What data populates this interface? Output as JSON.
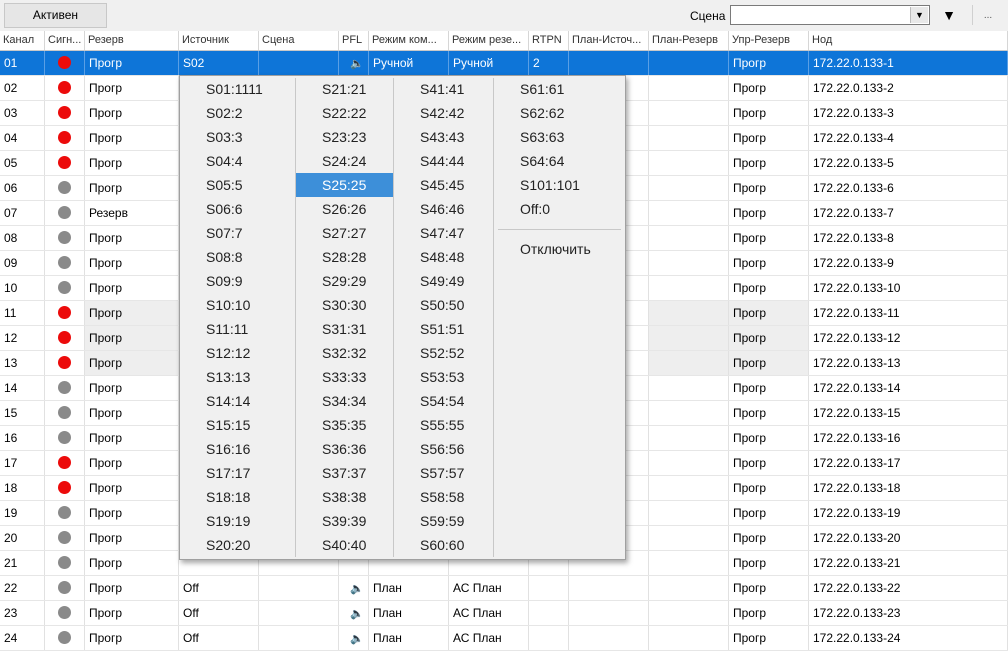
{
  "toolbar": {
    "active_label": "Активен",
    "scene_label": "Сцена",
    "scene_value": "",
    "more_label": "..."
  },
  "columns": [
    "Канал",
    "Сигн...",
    "Резерв",
    "Источник",
    "Сцена",
    "PFL",
    "Режим ком...",
    "Режим резе...",
    "RTPN",
    "План-Источ...",
    "План-Резерв",
    "Упр-Резерв",
    "Нод"
  ],
  "rows": [
    {
      "channel": "01",
      "signal": "red",
      "reserve": "Прогр",
      "source": "S02",
      "mode_com": "Ручной",
      "mode_res": "Ручной",
      "rtpn": "2",
      "upr": "Прогр",
      "node": "172.22.0.133-1",
      "selected": true,
      "pfl": true
    },
    {
      "channel": "02",
      "signal": "red",
      "reserve": "Прогр",
      "upr": "Прогр",
      "node": "172.22.0.133-2"
    },
    {
      "channel": "03",
      "signal": "red",
      "reserve": "Прогр",
      "upr": "Прогр",
      "node": "172.22.0.133-3"
    },
    {
      "channel": "04",
      "signal": "red",
      "reserve": "Прогр",
      "upr": "Прогр",
      "node": "172.22.0.133-4"
    },
    {
      "channel": "05",
      "signal": "red",
      "reserve": "Прогр",
      "upr": "Прогр",
      "node": "172.22.0.133-5"
    },
    {
      "channel": "06",
      "signal": "gray",
      "reserve": "Прогр",
      "upr": "Прогр",
      "node": "172.22.0.133-6"
    },
    {
      "channel": "07",
      "signal": "gray",
      "reserve": "Резерв",
      "upr": "Прогр",
      "node": "172.22.0.133-7"
    },
    {
      "channel": "08",
      "signal": "gray",
      "reserve": "Прогр",
      "upr": "Прогр",
      "node": "172.22.0.133-8"
    },
    {
      "channel": "09",
      "signal": "gray",
      "reserve": "Прогр",
      "upr": "Прогр",
      "node": "172.22.0.133-9"
    },
    {
      "channel": "10",
      "signal": "gray",
      "reserve": "Прогр",
      "upr": "Прогр",
      "node": "172.22.0.133-10"
    },
    {
      "channel": "11",
      "signal": "red",
      "reserve": "Прогр",
      "upr": "Прогр",
      "node": "172.22.0.133-11",
      "shaded": true
    },
    {
      "channel": "12",
      "signal": "red",
      "reserve": "Прогр",
      "upr": "Прогр",
      "node": "172.22.0.133-12",
      "shaded": true
    },
    {
      "channel": "13",
      "signal": "red",
      "reserve": "Прогр",
      "upr": "Прогр",
      "node": "172.22.0.133-13",
      "shaded": true
    },
    {
      "channel": "14",
      "signal": "gray",
      "reserve": "Прогр",
      "upr": "Прогр",
      "node": "172.22.0.133-14"
    },
    {
      "channel": "15",
      "signal": "gray",
      "reserve": "Прогр",
      "upr": "Прогр",
      "node": "172.22.0.133-15"
    },
    {
      "channel": "16",
      "signal": "gray",
      "reserve": "Прогр",
      "upr": "Прогр",
      "node": "172.22.0.133-16"
    },
    {
      "channel": "17",
      "signal": "red",
      "reserve": "Прогр",
      "upr": "Прогр",
      "node": "172.22.0.133-17"
    },
    {
      "channel": "18",
      "signal": "red",
      "reserve": "Прогр",
      "upr": "Прогр",
      "node": "172.22.0.133-18"
    },
    {
      "channel": "19",
      "signal": "gray",
      "reserve": "Прогр",
      "upr": "Прогр",
      "node": "172.22.0.133-19"
    },
    {
      "channel": "20",
      "signal": "gray",
      "reserve": "Прогр",
      "upr": "Прогр",
      "node": "172.22.0.133-20"
    },
    {
      "channel": "21",
      "signal": "gray",
      "reserve": "Прогр",
      "upr": "Прогр",
      "node": "172.22.0.133-21"
    },
    {
      "channel": "22",
      "signal": "gray",
      "reserve": "Прогр",
      "source": "Off",
      "mode_com": "План",
      "mode_res": "АС План",
      "upr": "Прогр",
      "node": "172.22.0.133-22",
      "pfl": true
    },
    {
      "channel": "23",
      "signal": "gray",
      "reserve": "Прогр",
      "source": "Off",
      "mode_com": "План",
      "mode_res": "АС План",
      "upr": "Прогр",
      "node": "172.22.0.133-23",
      "pfl": true
    },
    {
      "channel": "24",
      "signal": "gray",
      "reserve": "Прогр",
      "source": "Off",
      "mode_com": "План",
      "mode_res": "АС План",
      "upr": "Прогр",
      "node": "172.22.0.133-24",
      "pfl": true
    }
  ],
  "popup": {
    "columns": [
      {
        "items": [
          "S01:1111",
          "S02:2",
          "S03:3",
          "S04:4",
          "S05:5",
          "S06:6",
          "S07:7",
          "S08:8",
          "S09:9",
          "S10:10",
          "S11:11",
          "S12:12",
          "S13:13",
          "S14:14",
          "S15:15",
          "S16:16",
          "S17:17",
          "S18:18",
          "S19:19",
          "S20:20"
        ]
      },
      {
        "items": [
          "S21:21",
          "S22:22",
          "S23:23",
          "S24:24",
          "S25:25",
          "S26:26",
          "S27:27",
          "S28:28",
          "S29:29",
          "S30:30",
          "S31:31",
          "S32:32",
          "S33:33",
          "S34:34",
          "S35:35",
          "S36:36",
          "S37:37",
          "S38:38",
          "S39:39",
          "S40:40"
        ]
      },
      {
        "items": [
          "S41:41",
          "S42:42",
          "S43:43",
          "S44:44",
          "S45:45",
          "S46:46",
          "S47:47",
          "S48:48",
          "S49:49",
          "S50:50",
          "S51:51",
          "S52:52",
          "S53:53",
          "S54:54",
          "S55:55",
          "S56:56",
          "S57:57",
          "S58:58",
          "S59:59",
          "S60:60"
        ]
      },
      {
        "items": [
          "S61:61",
          "S62:62",
          "S63:63",
          "S64:64",
          "S101:101",
          "Off:0"
        ]
      }
    ],
    "highlighted": "S25:25",
    "disable_label": "Отключить"
  },
  "icons": {
    "speaker": "speaker-icon",
    "signal": "signal-indicator-icon",
    "dropdown": "chevron-down-icon"
  },
  "colors": {
    "selection": "#0e75d8",
    "signal_on": "#ec0b0b",
    "signal_off": "#8a8a8a",
    "menu_highlight": "#3d8fd9"
  }
}
